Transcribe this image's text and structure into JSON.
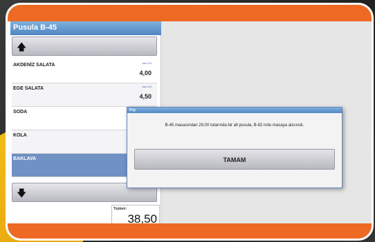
{
  "window": {
    "title": "Pusula B-45"
  },
  "nav": {
    "up_arrow": "🡅",
    "down_arrow": "🡇"
  },
  "items": [
    {
      "name": "AKDENİZ SALATA",
      "code": "sss 113",
      "price": "4,00"
    },
    {
      "name": "EGE SALATA",
      "code": "sss 113",
      "price": "4,50"
    },
    {
      "name": "SODA",
      "code": "",
      "price": ""
    },
    {
      "name": "KOLA",
      "code": "",
      "price": ""
    },
    {
      "name": "BAKLAVA",
      "code": "",
      "price": ""
    }
  ],
  "total": {
    "label": "Toplam:",
    "value": "38,50"
  },
  "dialog": {
    "title": "Bilgi",
    "message": "B-45 masasından 29,00 tutarında bir alt pusula, B-82 nolu masaya alıcınıdı.",
    "ok_label": "TAMAM"
  },
  "colors": {
    "accent": "#ee6a24",
    "title_bar": "#4f86c1",
    "selected_row": "#6f91c3",
    "yellow": "#f3c21a"
  },
  "selected_index": 4
}
